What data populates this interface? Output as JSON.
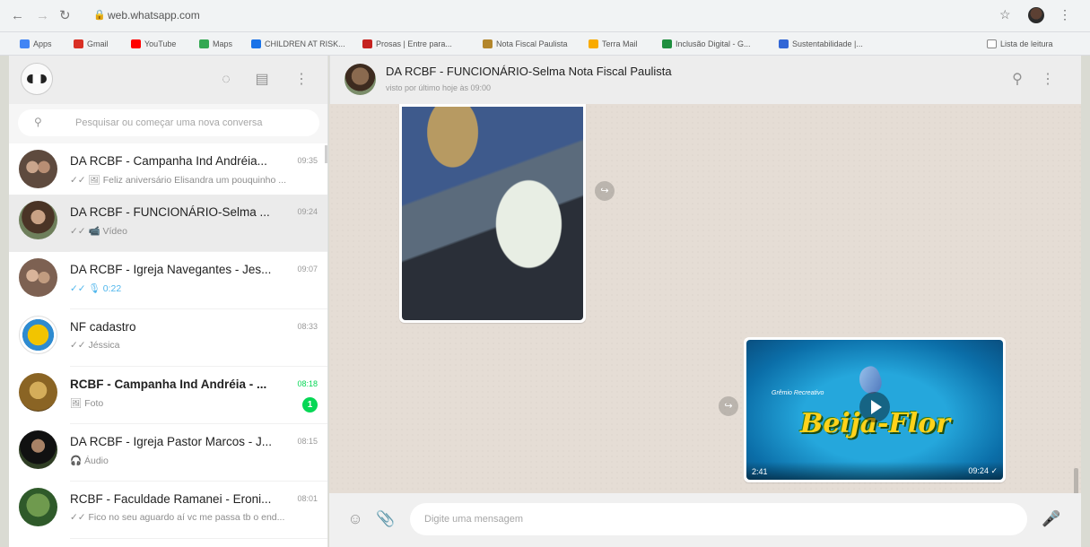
{
  "browser": {
    "url": "web.whatsapp.com",
    "bookmarks": [
      {
        "label": "Apps",
        "color": "#4285f4"
      },
      {
        "label": "Gmail",
        "color": "#d93025"
      },
      {
        "label": "YouTube",
        "color": "#ff0000"
      },
      {
        "label": "Maps",
        "color": "#34a853"
      },
      {
        "label": "CHILDREN AT RISK...",
        "color": "#1a73e8"
      },
      {
        "label": "Prosas | Entre para...",
        "color": "#c5221f"
      },
      {
        "label": "Nota Fiscal Paulista",
        "color": "#b3862c"
      },
      {
        "label": "Terra Mail",
        "color": "#f9ab00"
      },
      {
        "label": "Inclusão Digital - G...",
        "color": "#1e8e3e"
      },
      {
        "label": "Sustentabilidade |...",
        "color": "#3367d6"
      }
    ],
    "reading_list": "Lista de leitura"
  },
  "sidebar": {
    "search_placeholder": "Pesquisar ou começar uma nova conversa",
    "chats": [
      {
        "name": "DA RCBF - Campanha Ind Andréia...",
        "time": "09:35",
        "preview": "✓✓ 🖼 Feliz aniversário Elisandra um pouquinho ...",
        "avatar": "#6f5a4d"
      },
      {
        "name": "DA RCBF - FUNCIONÁRIO-Selma ...",
        "time": "09:24",
        "preview": "✓✓ 📹 Vídeo",
        "avatar": "#5b4636",
        "active": true
      },
      {
        "name": "DA RCBF - Igreja Navegantes - Jes...",
        "time": "09:07",
        "preview": "✓✓ 🎙 0:22",
        "avatar": "#8a6a57"
      },
      {
        "name": "NF cadastro",
        "time": "08:33",
        "preview": "✓✓ Jéssica",
        "avatar": "#f2c400"
      },
      {
        "name": "RCBF - Campanha Ind Andréia - ...",
        "time": "08:18",
        "preview": "🖼 Foto",
        "avatar": "#b48a3a",
        "unread": "1"
      },
      {
        "name": "DA RCBF - Igreja Pastor Marcos - J...",
        "time": "08:15",
        "preview": "🎧 Áudio",
        "avatar": "#2d2d2d"
      },
      {
        "name": "RCBF - Faculdade Ramanei - Eroni...",
        "time": "08:01",
        "preview": "✓✓ Fico no seu aguardo aí vc me passa tb o end...",
        "avatar": "#4d7a3a"
      }
    ]
  },
  "conversation": {
    "title": "DA RCBF - FUNCIONÁRIO-Selma Nota Fiscal Paulista",
    "subtitle": "visto por último hoje às 09:00",
    "video": {
      "logo_text": "Beija-Flor",
      "tagline": "Grêmio Recreativo",
      "duration": "2:41",
      "time": "09:24 ✓"
    },
    "compose_placeholder": "Digite uma mensagem"
  }
}
